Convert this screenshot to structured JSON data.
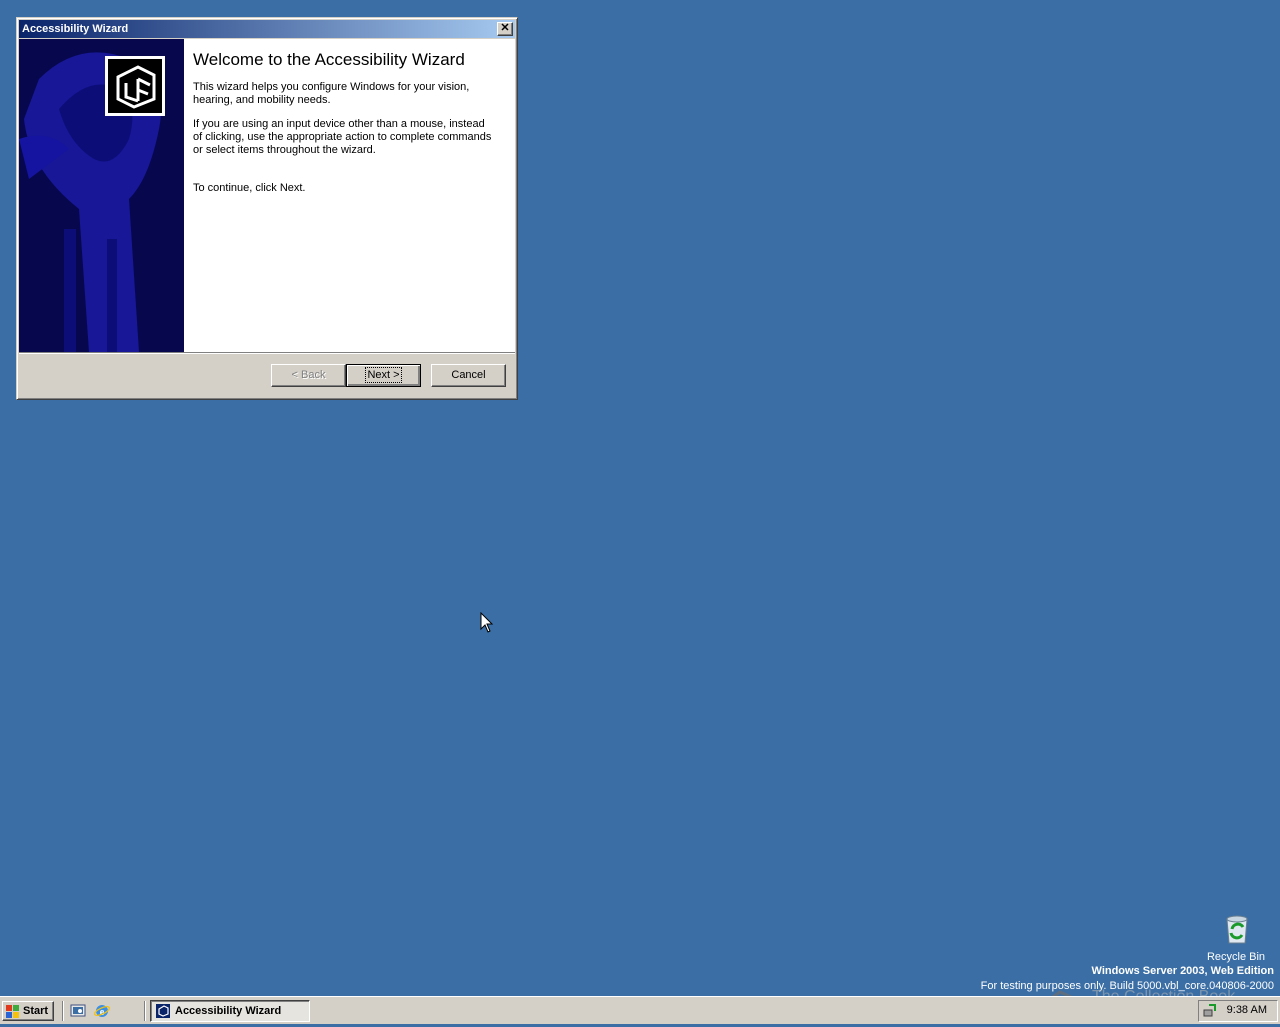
{
  "dialog": {
    "title": "Accessibility Wizard",
    "close_glyph": "✕",
    "heading": "Welcome to the Accessibility Wizard",
    "paragraph1": "This wizard helps you configure Windows for your vision, hearing, and mobility needs.",
    "paragraph2": "If you are using an input device other than a mouse, instead of clicking, use the appropriate action to complete commands or select items throughout the wizard.",
    "continue_text": "To continue, click Next.",
    "back_label": "< Back",
    "next_label": "Next >",
    "cancel_label": "Cancel"
  },
  "desktop": {
    "background_color": "#3a6ea5",
    "recycle_bin_label": "Recycle Bin",
    "os_edition": "Windows Server 2003, Web Edition",
    "os_build": "For testing purposes only. Build 5000.vbl_core.040806-2000",
    "watermark": "The Collection Book"
  },
  "taskbar": {
    "start_label": "Start",
    "task_button_label": "Accessibility Wizard",
    "clock": "9:38 AM"
  },
  "icons": {
    "start": "windows-flag-icon",
    "quicklaunch_1": "show-desktop-icon",
    "quicklaunch_2": "internet-explorer-icon",
    "tray": "network-icon"
  }
}
